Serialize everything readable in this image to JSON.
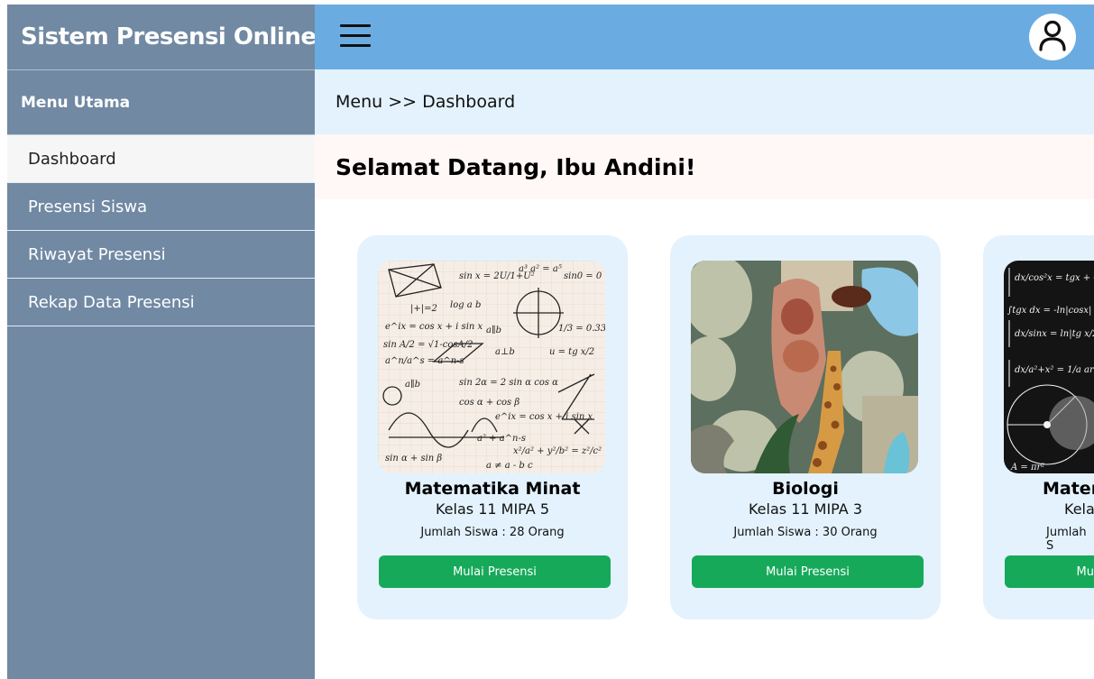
{
  "app": {
    "title": "Sistem Presensi Online"
  },
  "sidebar": {
    "menu_title": "Menu Utama",
    "items": [
      {
        "label": "Dashboard"
      },
      {
        "label": "Presensi Siswa"
      },
      {
        "label": "Riwayat Presensi"
      },
      {
        "label": "Rekap Data Presensi"
      }
    ]
  },
  "breadcrumb": {
    "text": "Menu >> Dashboard"
  },
  "welcome": {
    "text": "Selamat Datang, Ibu Andini!"
  },
  "cards": [
    {
      "title": "Matematika Minat",
      "class": "Kelas 11 MIPA 5",
      "count": "Jumlah Siswa : 28 Orang",
      "button": "Mulai Presensi"
    },
    {
      "title": "Biologi",
      "class": "Kelas 11 MIPA 3",
      "count": "Jumlah Siswa : 30 Orang",
      "button": "Mulai Presensi"
    },
    {
      "title": "Matem",
      "class": "Kela",
      "count": "Jumlah S",
      "button": "Mu"
    }
  ],
  "colors": {
    "sidebar": "#7189a3",
    "topbar": "#6aace2",
    "breadcrumb_bg": "#e3f2fd",
    "welcome_bg": "#fff8f6",
    "card_bg": "#e3f2fd",
    "button": "#16a95a"
  },
  "icons": {
    "menu": "hamburger-icon",
    "profile": "user-avatar-icon"
  }
}
